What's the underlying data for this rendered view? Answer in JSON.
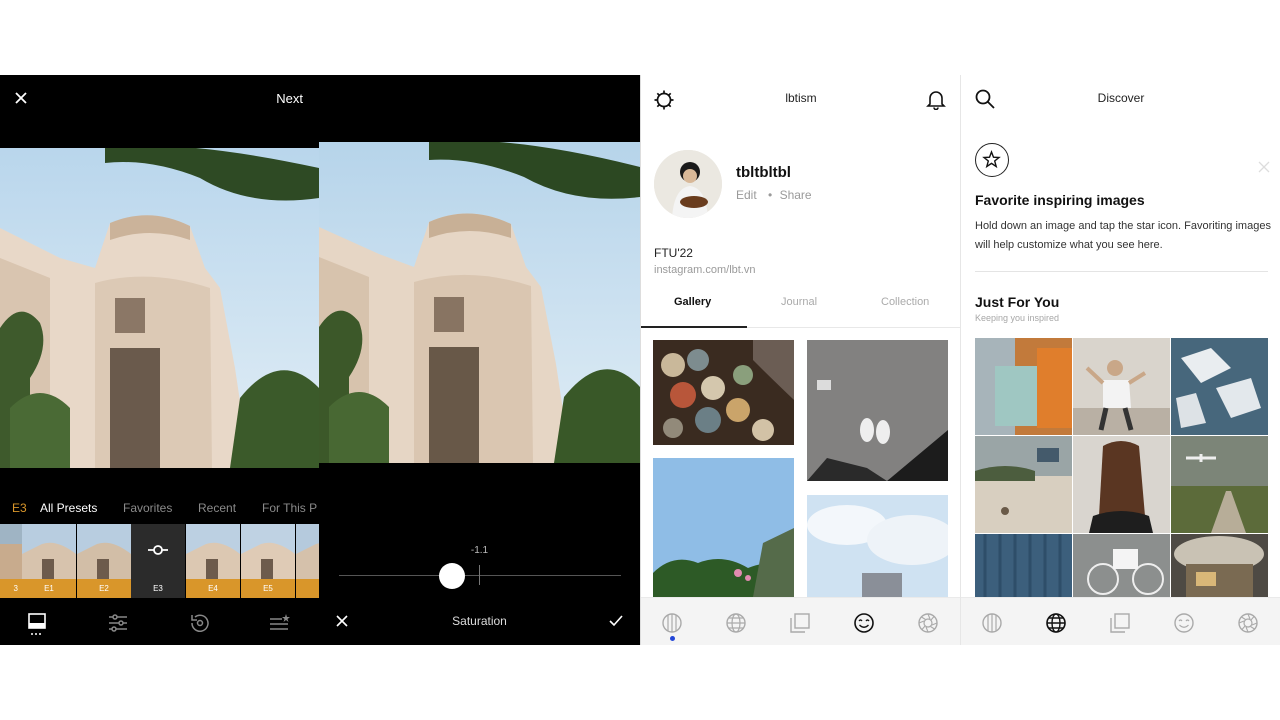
{
  "editor": {
    "next_label": "Next",
    "preset_tabs": [
      "E3",
      "All Presets",
      "Favorites",
      "Recent",
      "For This P"
    ],
    "thumbnails": [
      "3",
      "E1",
      "E2",
      "E3",
      "E4",
      "E5"
    ],
    "selected_preset": "E3",
    "toolbar_icons": [
      "presets-icon",
      "adjust-sliders-icon",
      "history-icon",
      "recipes-icon"
    ]
  },
  "adjust": {
    "value": "-1.1",
    "tool_title": "Saturation"
  },
  "profile": {
    "header_title": "lbtism",
    "username": "tbltbltbl",
    "edit_label": "Edit",
    "share_label": "Share",
    "bio": "FTU'22",
    "link": "instagram.com/lbt.vn",
    "tabs": [
      "Gallery",
      "Journal",
      "Collection"
    ],
    "active_tab": "Gallery",
    "nav_icons": [
      "vsco-icon",
      "globe-icon",
      "studio-icon",
      "smiley-icon",
      "camera-shutter-icon"
    ]
  },
  "discover": {
    "header_title": "Discover",
    "card_title": "Favorite inspiring images",
    "card_desc": "Hold down an image and tap the star icon. Favoriting images will help customize what you see here.",
    "section_title": "Just For You",
    "section_subtitle": "Keeping you inspired",
    "nav_icons": [
      "vsco-icon",
      "globe-icon",
      "studio-icon",
      "smiley-icon",
      "camera-shutter-icon"
    ]
  },
  "colors": {
    "accent_orange": "#d9962a",
    "nav_dot_blue": "#2346d8"
  }
}
